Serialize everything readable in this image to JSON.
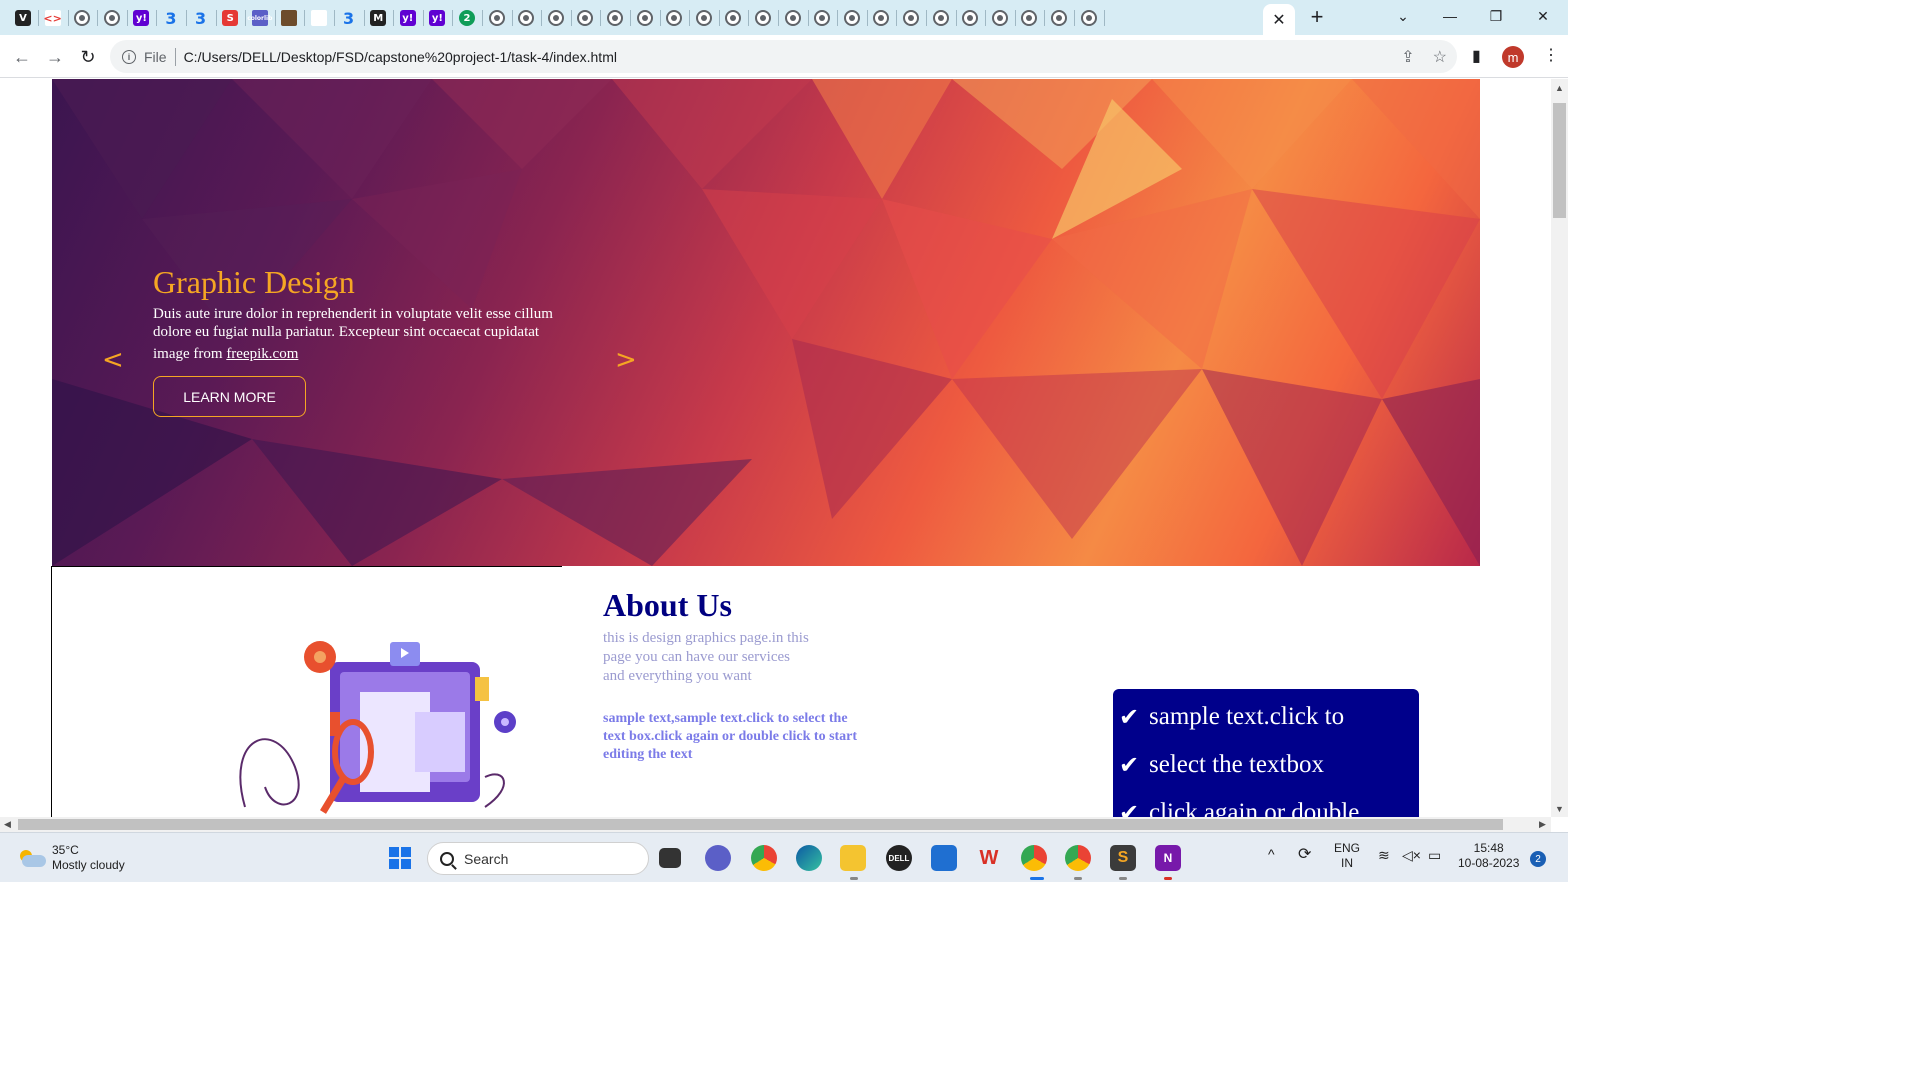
{
  "browser": {
    "active_tab_close": "✕",
    "new_tab": "+",
    "tab_favicons": [
      "V",
      "<>",
      "globe",
      "globe",
      "y!",
      "3",
      "3",
      "S",
      "colorlib",
      "book",
      "white",
      "3",
      "M",
      "y!",
      "y!",
      "2",
      "globe",
      "globe",
      "globe",
      "globe",
      "globe",
      "globe",
      "globe",
      "globe",
      "globe",
      "globe",
      "globe",
      "globe",
      "globe",
      "globe",
      "globe",
      "globe",
      "globe",
      "globe",
      "globe",
      "globe",
      "globe"
    ],
    "window_controls": {
      "chevron": "⌄",
      "minimize": "—",
      "restore": "❐",
      "close": "✕"
    },
    "nav": {
      "back": "←",
      "forward": "→",
      "reload": "↻"
    },
    "address": {
      "scheme_label": "File",
      "url": "C:/Users/DELL/Desktop/FSD/capstone%20project-1/task-4/index.html"
    },
    "profile_initial": "m",
    "menu": "⋮"
  },
  "page": {
    "hero": {
      "title": "Graphic Design",
      "text": "Duis aute irure dolor in reprehenderit in voluptate velit esse cillum dolore eu fugiat nulla pariatur. Excepteur sint occaecat cupidatat",
      "credit_prefix": "image from ",
      "credit_link": "freepik.com",
      "button": "LEARN MORE",
      "prev": "<",
      "next": ">"
    },
    "about": {
      "title": "About Us",
      "description": "this is design graphics page.in this page you can have our services and everything you want",
      "bold_text": "sample text,sample text.click to select the text box.click again or double click to start editing the text",
      "checklist": [
        "sample text.click to",
        "select the textbox",
        "click again or double"
      ]
    }
  },
  "taskbar": {
    "weather": {
      "temp": "35°C",
      "condition": "Mostly cloudy"
    },
    "search_label": "Search",
    "language": {
      "line1": "ENG",
      "line2": "IN"
    },
    "clock": {
      "time": "15:48",
      "date": "10-08-2023"
    },
    "notification_count": "2"
  }
}
